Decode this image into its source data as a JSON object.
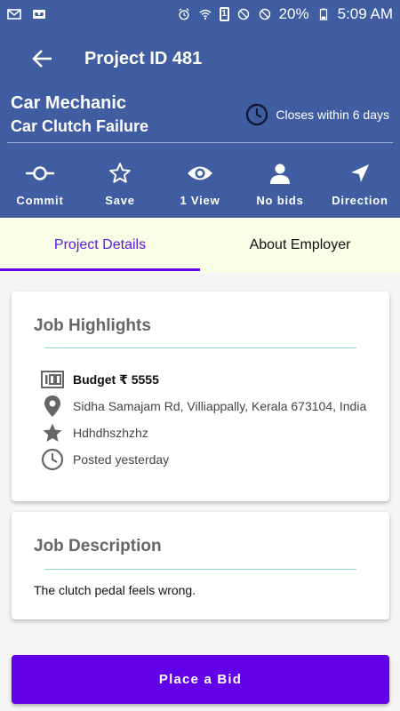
{
  "status_bar": {
    "battery_level": "1",
    "battery_percent": "20%",
    "time": "5:09 AM"
  },
  "header": {
    "title": "Project ID 481",
    "job_category": "Car Mechanic",
    "job_name": "Car Clutch Failure",
    "closes": "Closes within 6 days"
  },
  "actions": [
    {
      "label": "Commit",
      "icon": "commit-icon"
    },
    {
      "label": "Save",
      "icon": "star-outline-icon"
    },
    {
      "label": "1 View",
      "icon": "eye-icon"
    },
    {
      "label": "No bids",
      "icon": "person-icon"
    },
    {
      "label": "Direction",
      "icon": "navigation-icon"
    }
  ],
  "tabs": [
    {
      "label": "Project Details",
      "active": true
    },
    {
      "label": "About Employer",
      "active": false
    }
  ],
  "highlights": {
    "title": "Job Highlights",
    "budget": "Budget ₹ 5555",
    "location": "Sidha Samajam Rd, Villiappally, Kerala 673104, India",
    "skill": "Hdhdhszhzhz",
    "posted": "Posted yesterday"
  },
  "description": {
    "title": "Job Description",
    "text": "The clutch pedal feels wrong."
  },
  "bid_button": "Place a Bid",
  "colors": {
    "primary": "#3f5da0",
    "accent": "#6200ea",
    "tab_bg": "#f9fde6"
  }
}
